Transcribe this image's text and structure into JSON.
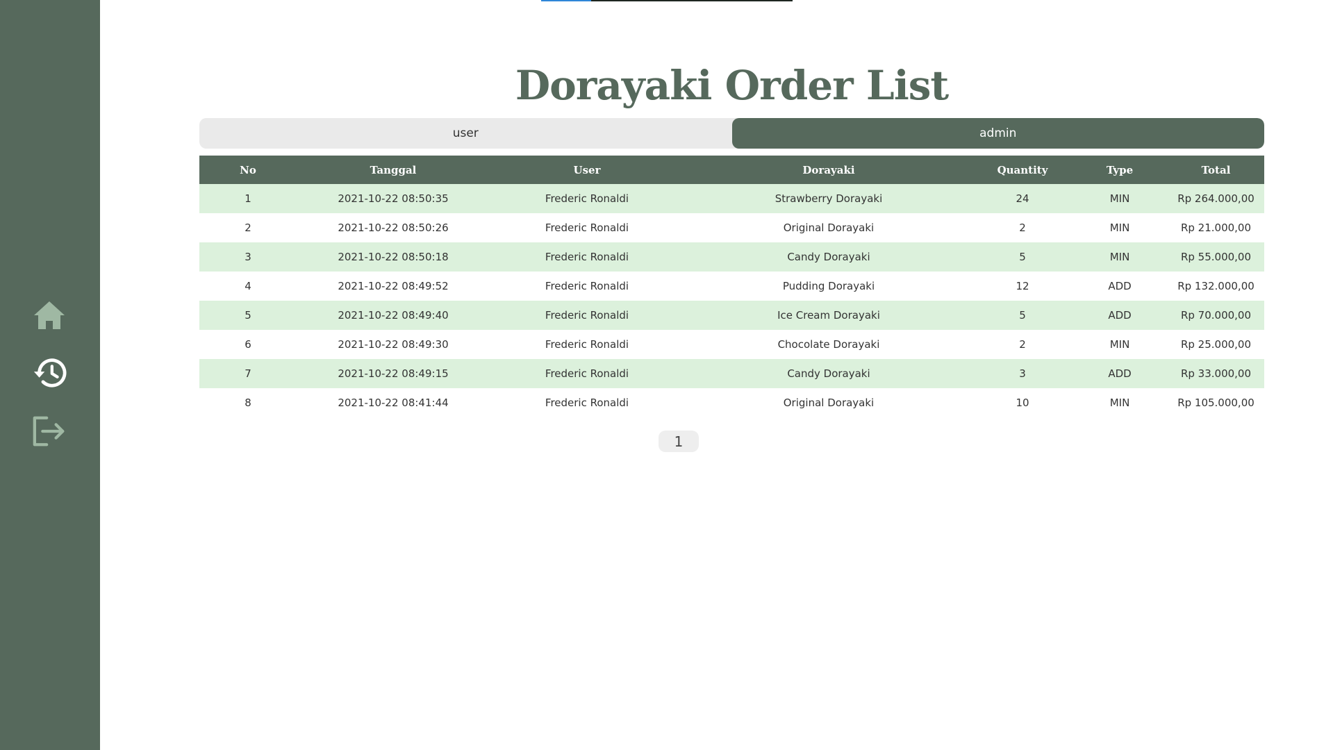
{
  "progress": {
    "fraction": 0.2,
    "track_color": "#1e2620",
    "fill_color": "#2f86d8"
  },
  "sidebar": {
    "background": "#56695c",
    "items": [
      {
        "icon": "home-icon",
        "color": "#9fb8a3"
      },
      {
        "icon": "history-icon",
        "color": "#ffffff",
        "active": true
      },
      {
        "icon": "logout-icon",
        "color": "#9fb8a3"
      }
    ]
  },
  "page": {
    "title": "Dorayaki Order List"
  },
  "toggle": {
    "user_label": "user",
    "admin_label": "admin",
    "active": "admin"
  },
  "table": {
    "headers": [
      "No",
      "Tanggal",
      "User",
      "Dorayaki",
      "Quantity",
      "Type",
      "Total"
    ],
    "rows": [
      [
        "1",
        "2021-10-22 08:50:35",
        "Frederic Ronaldi",
        "Strawberry Dorayaki",
        "24",
        "MIN",
        "Rp 264.000,00"
      ],
      [
        "2",
        "2021-10-22 08:50:26",
        "Frederic Ronaldi",
        "Original Dorayaki",
        "2",
        "MIN",
        "Rp 21.000,00"
      ],
      [
        "3",
        "2021-10-22 08:50:18",
        "Frederic Ronaldi",
        "Candy Dorayaki",
        "5",
        "MIN",
        "Rp 55.000,00"
      ],
      [
        "4",
        "2021-10-22 08:49:52",
        "Frederic Ronaldi",
        "Pudding Dorayaki",
        "12",
        "ADD",
        "Rp 132.000,00"
      ],
      [
        "5",
        "2021-10-22 08:49:40",
        "Frederic Ronaldi",
        "Ice Cream Dorayaki",
        "5",
        "ADD",
        "Rp 70.000,00"
      ],
      [
        "6",
        "2021-10-22 08:49:30",
        "Frederic Ronaldi",
        "Chocolate Dorayaki",
        "2",
        "MIN",
        "Rp 25.000,00"
      ],
      [
        "7",
        "2021-10-22 08:49:15",
        "Frederic Ronaldi",
        "Candy Dorayaki",
        "3",
        "ADD",
        "Rp 33.000,00"
      ],
      [
        "8",
        "2021-10-22 08:41:44",
        "Frederic Ronaldi",
        "Original Dorayaki",
        "10",
        "MIN",
        "Rp 105.000,00"
      ]
    ],
    "header_color": "#56695c",
    "stripe_color": "#dcf1dc"
  },
  "pagination": {
    "pages": [
      "1"
    ],
    "current": "1"
  }
}
